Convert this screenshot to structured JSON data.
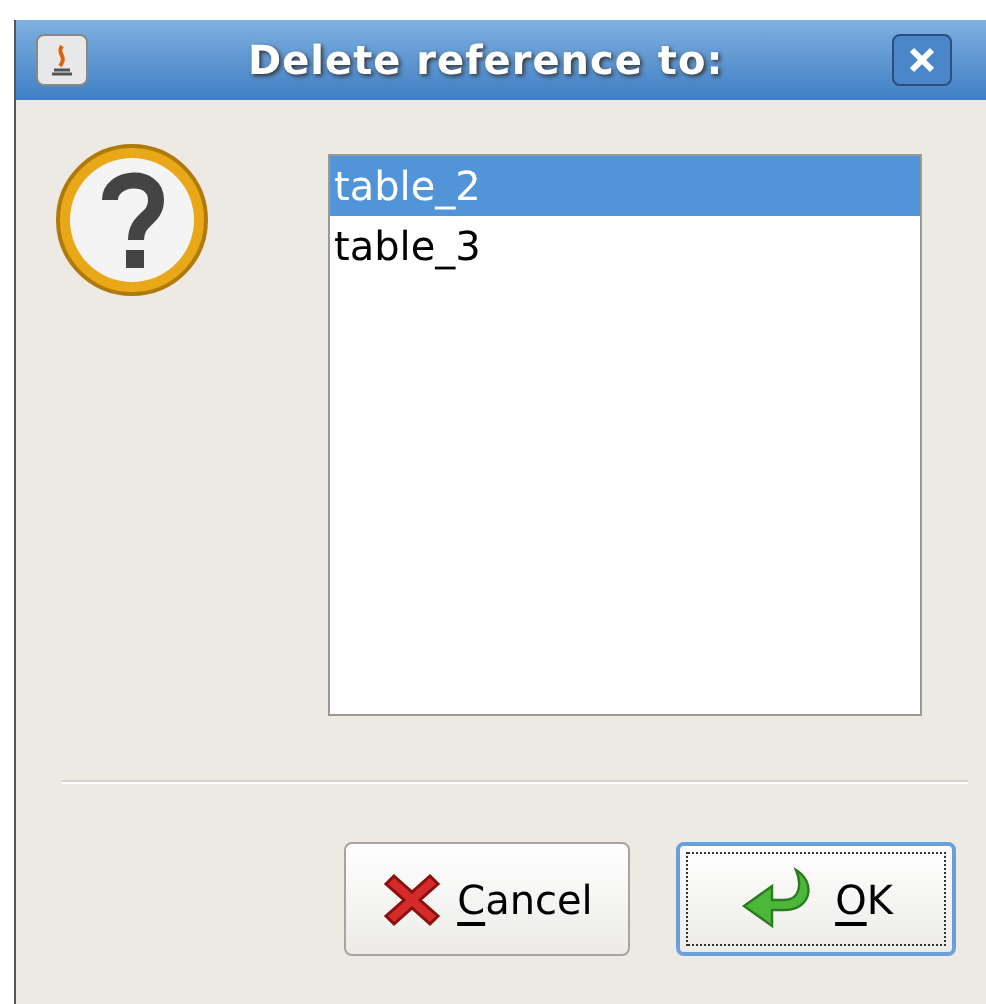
{
  "window": {
    "title": "Delete reference to:"
  },
  "list": {
    "items": [
      {
        "label": "table_2",
        "selected": true
      },
      {
        "label": "table_3",
        "selected": false
      }
    ]
  },
  "buttons": [
    {
      "kind": "cancel",
      "label": "Cancel",
      "mnemonic": true,
      "focused": false
    },
    {
      "kind": "ok",
      "label": "OK",
      "mnemonic": true,
      "focused": true
    }
  ]
}
